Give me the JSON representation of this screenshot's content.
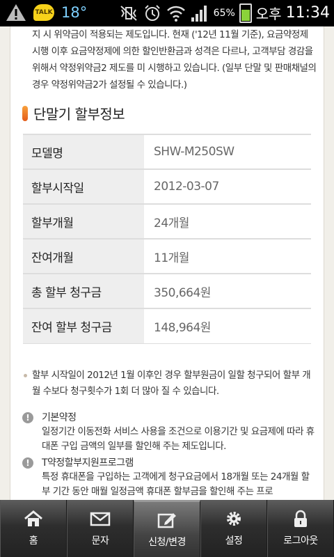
{
  "status_bar": {
    "temperature": "18°",
    "talk_icon_text": "TALK",
    "battery_percent": "65%",
    "battery_level": 0.65,
    "ampm": "오후",
    "time": "11:34"
  },
  "intro_text": "지 시 위약금이 적용되는 제도입니다. 현재 ('12년 11월 기준), 요금약정제 시행 이후 요금약정제에 의한 할인반환금과 성격은 다르나, 고객부담 경감을 위해서 약정위약금2 제도를 미 시행하고 있습니다. (일부 단말 및 판매채널의 경우 약정위약금2가 설정될 수 있습니다.)",
  "section": {
    "title": "단말기 할부정보"
  },
  "installment_table": [
    {
      "label": "모델명",
      "value": "SHW-M250SW"
    },
    {
      "label": "할부시작일",
      "value": "2012-03-07"
    },
    {
      "label": "할부개월",
      "value": "24개월"
    },
    {
      "label": "잔여개월",
      "value": "11개월"
    },
    {
      "label": "총 할부 청구금",
      "value": "350,664원"
    },
    {
      "label": "잔여 할부 청구금",
      "value": "148,964원"
    }
  ],
  "note": "할부 시작일이 2012년 1월 이후인 경우 할부원금이 일할 청구되어 할부 개월 수보다 청구횟수가 1회 더 많아 질 수 있습니다.",
  "terms": [
    {
      "icon": "!",
      "title": "기본약정",
      "body": "일정기간 이동전화 서비스 사용을 조건으로 이용기간 및 요금제에 따라 휴대폰 구입 금액의 일부를 할인해 주는 제도입니다."
    },
    {
      "icon": "!",
      "title": "T약정할부지원프로그램",
      "body": "특정 휴대폰을 구입하는 고객에게 청구요금에서 18개월 또는 24개월 할부 기간 동안 매월 일정금액 휴대폰 할부금을 할인해 주는 프로"
    }
  ],
  "tabs": [
    {
      "label": "홈",
      "icon": "home-icon"
    },
    {
      "label": "문자",
      "icon": "mail-icon"
    },
    {
      "label": "신청/변경",
      "icon": "edit-icon",
      "active": true
    },
    {
      "label": "설정",
      "icon": "gear-icon"
    },
    {
      "label": "로그아웃",
      "icon": "lock-icon"
    }
  ]
}
